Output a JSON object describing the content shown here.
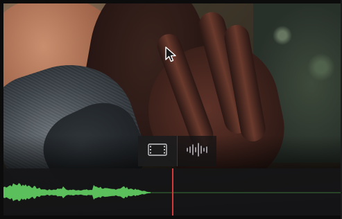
{
  "viewer": {
    "frame": "video-frame-woman-denim-jacket"
  },
  "controls": {
    "video_view_icon": "filmstrip-icon",
    "audio_view_icon": "audio-waveform-icon",
    "active_view": "video"
  },
  "audio": {
    "waveform_color": "#5bbf5b",
    "playhead_color": "#d23a3a",
    "playhead_position": 0.5
  },
  "cursor": {
    "icon": "pointer-cursor-icon"
  }
}
